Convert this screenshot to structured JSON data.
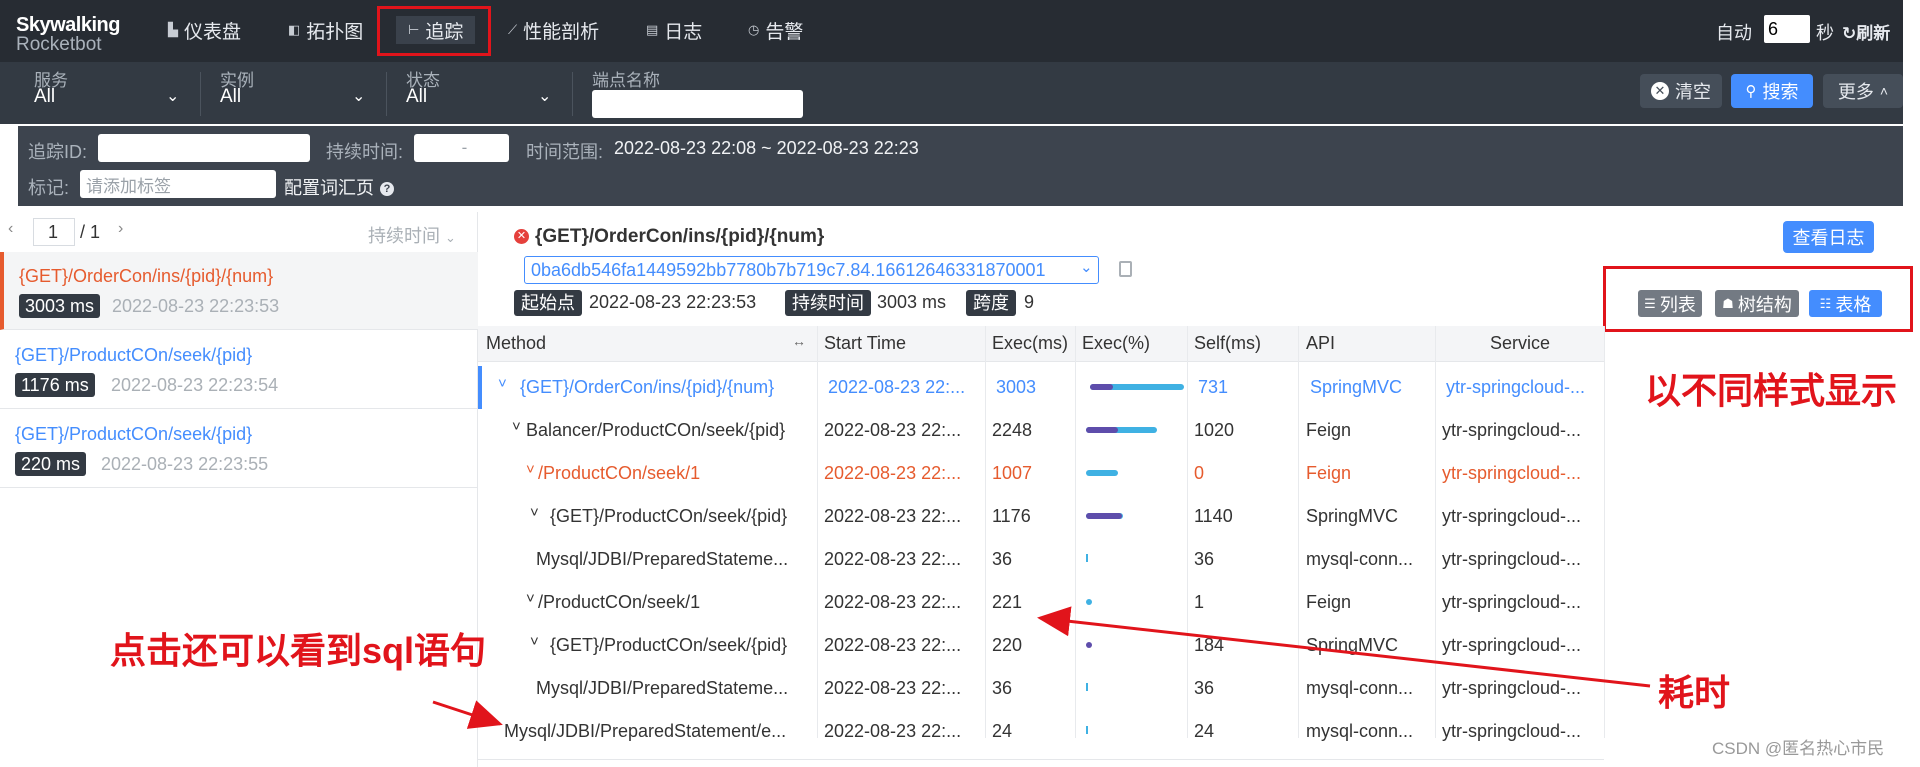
{
  "brand": {
    "line1": "Skywalking",
    "line2": "Rocketbot"
  },
  "nav": [
    {
      "label": "仪表盘",
      "icon": "dashboard-icon",
      "active": false
    },
    {
      "label": "拓扑图",
      "icon": "topology-icon",
      "active": false
    },
    {
      "label": "追踪",
      "icon": "trace-icon",
      "active": true
    },
    {
      "label": "性能剖析",
      "icon": "profile-icon",
      "active": false
    },
    {
      "label": "日志",
      "icon": "log-icon",
      "active": false
    },
    {
      "label": "告警",
      "icon": "alarm-icon",
      "active": false
    }
  ],
  "auto_refresh": {
    "label": "自动",
    "value": "6",
    "unit": "秒",
    "refresh_label": "刷新"
  },
  "filters": {
    "service": {
      "label": "服务",
      "value": "All"
    },
    "instance": {
      "label": "实例",
      "value": "All"
    },
    "status": {
      "label": "状态",
      "value": "All"
    },
    "endpoint": {
      "label": "端点名称",
      "value": ""
    },
    "clear_label": "清空",
    "search_label": "搜索",
    "more_label": "更多"
  },
  "filters2": {
    "trace_id_label": "追踪ID:",
    "duration_label": "持续时间:",
    "duration_placeholder": "-",
    "time_range_label": "时间范围:",
    "time_range_value": "2022-08-23 22:08 ~ 2022-08-23 22:23",
    "tag_label": "标记:",
    "tag_placeholder": "请添加标签",
    "config_label": "配置词汇页",
    "help": "?"
  },
  "pager": {
    "current": "1",
    "total": "/ 1",
    "sort_label": "持续时间"
  },
  "traces": [
    {
      "endpoint": "{GET}/OrderCon/ins/{pid}/{num}",
      "duration": "3003 ms",
      "time": "2022-08-23 22:23:53",
      "selected": true
    },
    {
      "endpoint": "{GET}/ProductCOn/seek/{pid}",
      "duration": "1176 ms",
      "time": "2022-08-23 22:23:54",
      "selected": false
    },
    {
      "endpoint": "{GET}/ProductCOn/seek/{pid}",
      "duration": "220 ms",
      "time": "2022-08-23 22:23:55",
      "selected": false
    }
  ],
  "detail": {
    "title": "{GET}/OrderCon/ins/{pid}/{num}",
    "trace_id": "0ba6db546fa1449592bb7780b7b719c7.84.16612646331870001",
    "start_label": "起始点",
    "start_value": "2022-08-23 22:23:53",
    "duration_label": "持续时间",
    "duration_value": "3003 ms",
    "span_label": "跨度",
    "span_value": "9",
    "view_log_label": "查看日志",
    "views": [
      "列表",
      "树结构",
      "表格"
    ]
  },
  "table": {
    "headers": [
      "Method",
      "Start Time",
      "Exec(ms)",
      "Exec(%)",
      "Self(ms)",
      "API",
      "Service"
    ],
    "rows": [
      {
        "indent": 0,
        "toggle": "˅",
        "method": "{GET}/OrderCon/ins/{pid}/{num}",
        "start": "2022-08-23 22:...",
        "exec": "3003",
        "exec_pct": 1.0,
        "self_pct": 0.24,
        "self": "731",
        "api": "SpringMVC",
        "service": "ytr-springcloud-...",
        "style": "blue"
      },
      {
        "indent": 1,
        "toggle": "˅",
        "method": "Balancer/ProductCOn/seek/{pid}",
        "start": "2022-08-23 22:...",
        "exec": "2248",
        "exec_pct": 0.75,
        "self_pct": 0.34,
        "self": "1020",
        "api": "Feign",
        "service": "ytr-springcloud-...",
        "style": "normal"
      },
      {
        "indent": 2,
        "toggle": "˅",
        "method": "/ProductCOn/seek/1",
        "start": "2022-08-23 22:...",
        "exec": "1007",
        "exec_pct": 0.34,
        "self_pct": 0.0,
        "self": "0",
        "api": "Feign",
        "service": "ytr-springcloud-...",
        "style": "red"
      },
      {
        "indent": 3,
        "toggle": "˅",
        "method": "{GET}/ProductCOn/seek/{pid}",
        "start": "2022-08-23 22:...",
        "exec": "1176",
        "exec_pct": 0.39,
        "self_pct": 0.38,
        "self": "1140",
        "api": "SpringMVC",
        "service": "ytr-springcloud-...",
        "style": "normal"
      },
      {
        "indent": 4,
        "toggle": "",
        "method": "Mysql/JDBI/PreparedStateme...",
        "start": "2022-08-23 22:...",
        "exec": "36",
        "exec_pct": 0.012,
        "self_pct": 0.012,
        "self": "36",
        "api": "mysql-conn...",
        "service": "ytr-springcloud-...",
        "style": "normal"
      },
      {
        "indent": 2,
        "toggle": "˅",
        "method": "/ProductCOn/seek/1",
        "start": "2022-08-23 22:...",
        "exec": "221",
        "exec_pct": 0.074,
        "self_pct": 0.0,
        "self": "1",
        "api": "Feign",
        "service": "ytr-springcloud-...",
        "style": "normal"
      },
      {
        "indent": 3,
        "toggle": "˅",
        "method": "{GET}/ProductCOn/seek/{pid}",
        "start": "2022-08-23 22:...",
        "exec": "220",
        "exec_pct": 0.073,
        "self_pct": 0.061,
        "self": "184",
        "api": "SpringMVC",
        "service": "ytr-springcloud-...",
        "style": "normal"
      },
      {
        "indent": 4,
        "toggle": "",
        "method": "Mysql/JDBI/PreparedStateme...",
        "start": "2022-08-23 22:...",
        "exec": "36",
        "exec_pct": 0.012,
        "self_pct": 0.012,
        "self": "36",
        "api": "mysql-conn...",
        "service": "ytr-springcloud-...",
        "style": "normal"
      },
      {
        "indent": 0,
        "toggle": "",
        "method": "Mysql/JDBI/PreparedStatement/e...",
        "start": "2022-08-23 22:...",
        "exec": "24",
        "exec_pct": 0.008,
        "self_pct": 0.008,
        "self": "24",
        "api": "mysql-conn...",
        "service": "ytr-springcloud-...",
        "style": "normal"
      }
    ]
  },
  "annotations": {
    "styles": "以不同样式显示",
    "sql": "点击还可以看到sql语句",
    "time_cost": "耗时"
  },
  "watermark": "CSDN @匿名热心市民",
  "colors": {
    "accent": "#448dfe",
    "error": "#e65b2e",
    "annotation": "#e1141b",
    "nav_bg": "#272c33"
  }
}
